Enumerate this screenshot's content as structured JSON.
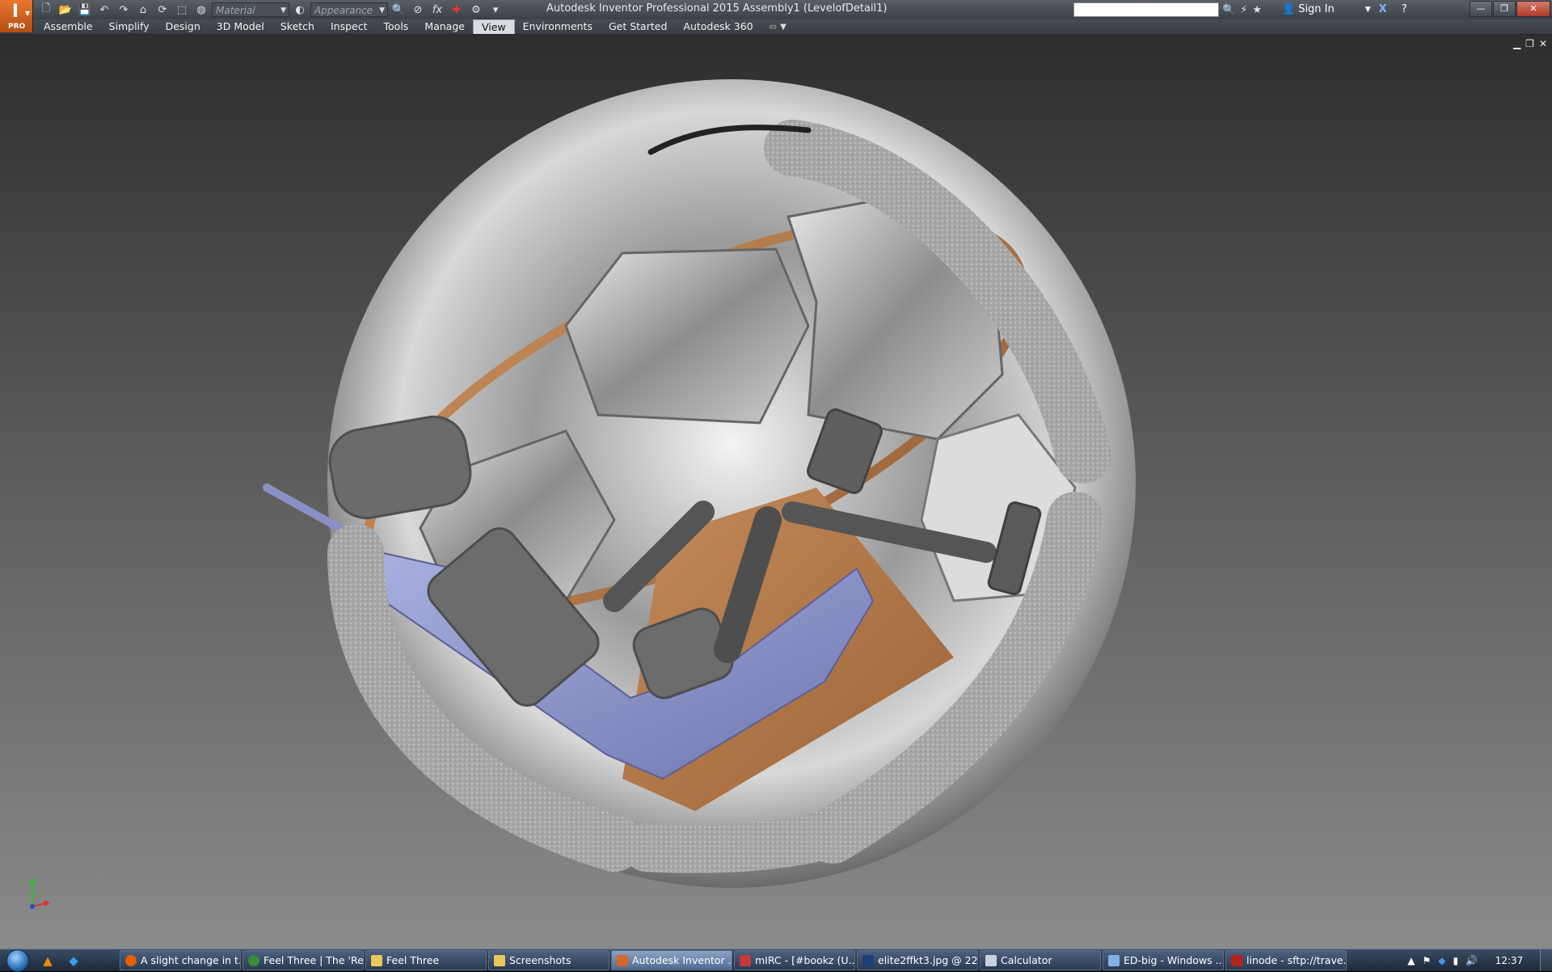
{
  "app": {
    "title": "Autodesk Inventor Professional 2015    Assembly1 (LevelofDetail1)",
    "badge": "PRO"
  },
  "quick_access": {
    "material_placeholder": "Material",
    "appearance_placeholder": "Appearance"
  },
  "help": {
    "signin_label": "Sign In"
  },
  "ribbon": {
    "tabs": [
      {
        "label": "Assemble"
      },
      {
        "label": "Simplify"
      },
      {
        "label": "Design"
      },
      {
        "label": "3D Model"
      },
      {
        "label": "Sketch"
      },
      {
        "label": "Inspect"
      },
      {
        "label": "Tools"
      },
      {
        "label": "Manage"
      },
      {
        "label": "View",
        "active": true
      },
      {
        "label": "Environments"
      },
      {
        "label": "Get Started"
      },
      {
        "label": "Autodesk 360"
      }
    ]
  },
  "taskbar": {
    "items": [
      {
        "label": "A slight change in t...",
        "icon": "firefox-icon",
        "color": "#e66000"
      },
      {
        "label": "Feel Three | The 'Re...",
        "icon": "chrome-icon",
        "color": "#3b8d3a"
      },
      {
        "label": "Feel Three",
        "icon": "folder-icon",
        "color": "#e8c75a"
      },
      {
        "label": "Screenshots",
        "icon": "folder-icon",
        "color": "#e8c75a"
      },
      {
        "label": "Autodesk Inventor ...",
        "icon": "inventor-icon",
        "color": "#d4662a",
        "active": true
      },
      {
        "label": "mIRC - [#bookz (U...",
        "icon": "mirc-icon",
        "color": "#c23a3a"
      },
      {
        "label": "elite2ffkt3.jpg @ 22...",
        "icon": "photoshop-icon",
        "color": "#1f3f7a"
      },
      {
        "label": "Calculator",
        "icon": "calculator-icon",
        "color": "#c9d3de"
      },
      {
        "label": "ED-big - Windows ...",
        "icon": "explorer-icon",
        "color": "#7fb2e6"
      },
      {
        "label": "linode - sftp://trave...",
        "icon": "filezilla-icon",
        "color": "#b5231e"
      }
    ],
    "clock": "12:37"
  }
}
